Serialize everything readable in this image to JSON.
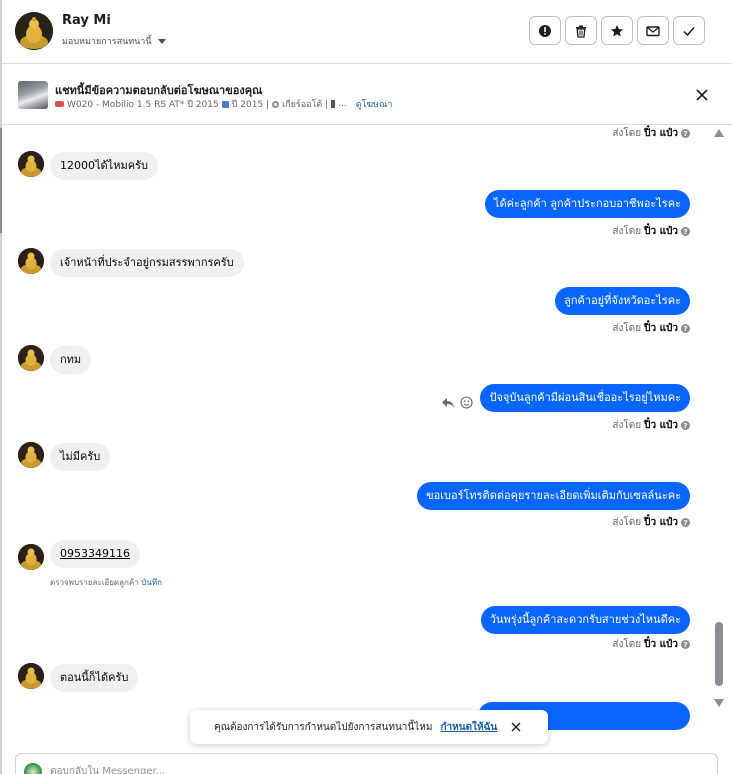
{
  "colors": {
    "accent": "#0866ff",
    "incoming_bubble": "#f0f0f0",
    "link": "#1c5fa8"
  },
  "header": {
    "name": "Ray Mi",
    "assign_label": "มอบหมายการสนทนานี้",
    "actions": [
      {
        "icon": "alert-icon"
      },
      {
        "icon": "trash-icon"
      },
      {
        "icon": "star-icon"
      },
      {
        "icon": "mail-icon"
      },
      {
        "icon": "check-icon"
      }
    ]
  },
  "ad_banner": {
    "title": "แชทนี้มีข้อความตอบกลับต่อโฆษณาของคุณ",
    "detail_model": "W020 - Mobilio 1.5 RS AT* ปี 2015",
    "detail_year": "ปี 2015 |",
    "detail_gear": "เกียร์ออโต้ |",
    "detail_more": "...",
    "link": "ดูโฆษณา"
  },
  "sent_by": {
    "prefix": "ส่งโดย",
    "agent": "ปิ๋ว แป๋ว"
  },
  "messages": [
    {
      "text": "12000ได้ไหมครับ"
    },
    {
      "text": "ได้ค่ะลูกค้า ลูกค้าประกอบอาชีพอะไรคะ"
    },
    {
      "text": "เจ้าหน้าที่ประจำอยู่กรมสรรพากรครับ"
    },
    {
      "text": "ลูกค้าอยู่ที่จังหวัดอะไรคะ"
    },
    {
      "text": "กทม"
    },
    {
      "text": "ปัจจุบันลูกค้ามีผ่อนสินเชื่ออะไรอยู่ไหมคะ"
    },
    {
      "text": "ไม่มีครับ"
    },
    {
      "text": "ขอเบอร์โทรติดต่อคุยรายละเอียดเพิ่มเติมกับเซลล์นะคะ"
    },
    {
      "text": "0953349116"
    },
    {
      "text": "วันพรุ่งนี้ลูกค้าสะดวกรับสายช่วงไหนดีคะ"
    },
    {
      "text": "ตอนนี้ก็ได้ครับ"
    }
  ],
  "phone_note": {
    "text": "ตรวจพบรายละเอียดลูกค้า",
    "link": "บันทึก"
  },
  "notice": {
    "text": "คุณต้องการได้รับการกำหนดไปยังการสนทนานี้ไหม",
    "link": "กำหนดให้ฉัน"
  },
  "composer": {
    "placeholder": "ตอบกลับใน Messenger..."
  }
}
